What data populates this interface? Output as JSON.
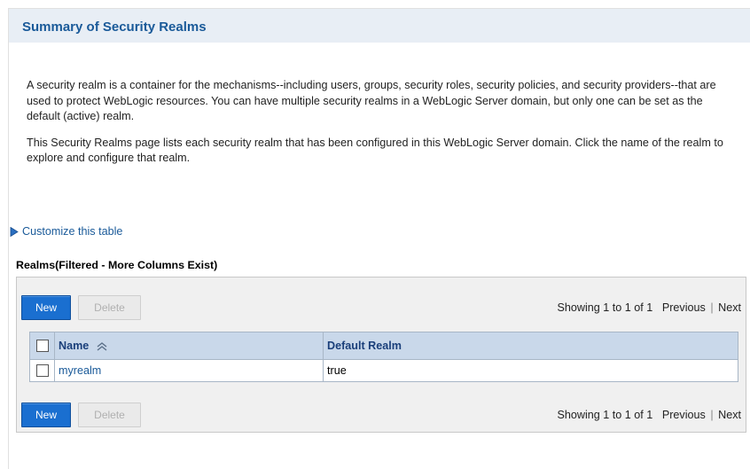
{
  "page": {
    "title": "Summary of Security Realms"
  },
  "intro": {
    "paragraph1": "A security realm is a container for the mechanisms--including users, groups, security roles, security policies, and security providers--that are used to protect WebLogic resources. You can have multiple security realms in a WebLogic Server domain, but only one can be set as the default (active) realm.",
    "paragraph2": "This Security Realms page lists each security realm that has been configured in this WebLogic Server domain. Click the name of the realm to explore and configure that realm."
  },
  "customize": {
    "label": "Customize this table",
    "icon": "triangle-right-icon"
  },
  "table": {
    "title": "Realms(Filtered - More Columns Exist)",
    "toolbar": {
      "new_label": "New",
      "delete_label": "Delete",
      "showing": "Showing 1 to 1 of 1",
      "previous": "Previous",
      "separator": "|",
      "next": "Next"
    },
    "columns": [
      "Name",
      "Default Realm"
    ],
    "rows": [
      {
        "name": "myrealm",
        "default_realm": "true"
      }
    ]
  },
  "colors": {
    "accent": "#1a5a99",
    "button_primary": "#1a6fd0",
    "header_bg": "#c9d8ea",
    "title_bg": "#e8eef5"
  }
}
